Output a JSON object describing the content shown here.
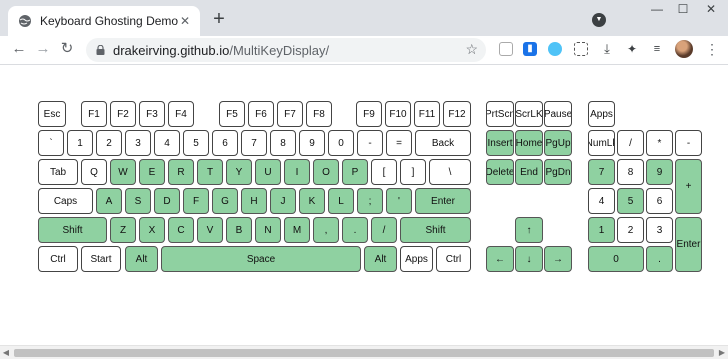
{
  "browser": {
    "tab_title": "Keyboard Ghosting Demonstratio",
    "tab_close": "✕",
    "new_tab": "+",
    "url_host": "drakeirving.github.io",
    "url_path": "/MultiKeyDisplay/",
    "back": "←",
    "forward": "→",
    "reload": "↻",
    "star": "☆",
    "menu": "⋮",
    "window_minimize": "—",
    "window_maximize": "☐",
    "window_close": "✕"
  },
  "colors": {
    "active_key": "#8fd1a1",
    "tab_strip": "#dee1e6"
  },
  "keys": [
    {
      "id": "esc",
      "label": "Esc",
      "active": false
    },
    {
      "id": "f1",
      "label": "F1",
      "active": false
    },
    {
      "id": "f2",
      "label": "F2",
      "active": false
    },
    {
      "id": "f3",
      "label": "F3",
      "active": false
    },
    {
      "id": "f4",
      "label": "F4",
      "active": false
    },
    {
      "id": "f5",
      "label": "F5",
      "active": false
    },
    {
      "id": "f6",
      "label": "F6",
      "active": false
    },
    {
      "id": "f7",
      "label": "F7",
      "active": false
    },
    {
      "id": "f8",
      "label": "F8",
      "active": false
    },
    {
      "id": "f9",
      "label": "F9",
      "active": false
    },
    {
      "id": "f10",
      "label": "F10",
      "active": false
    },
    {
      "id": "f11",
      "label": "F11",
      "active": false
    },
    {
      "id": "f12",
      "label": "F12",
      "active": false
    },
    {
      "id": "prtscn",
      "label": "PrtScn",
      "active": false
    },
    {
      "id": "scrlk",
      "label": "ScrLK",
      "active": false
    },
    {
      "id": "pause",
      "label": "Pause",
      "active": false
    },
    {
      "id": "apps-top",
      "label": "Apps",
      "active": false
    },
    {
      "id": "backtick",
      "label": "`",
      "active": false
    },
    {
      "id": "d1",
      "label": "1",
      "active": false
    },
    {
      "id": "d2",
      "label": "2",
      "active": false
    },
    {
      "id": "d3",
      "label": "3",
      "active": false
    },
    {
      "id": "d4",
      "label": "4",
      "active": false
    },
    {
      "id": "d5",
      "label": "5",
      "active": false
    },
    {
      "id": "d6",
      "label": "6",
      "active": false
    },
    {
      "id": "d7",
      "label": "7",
      "active": false
    },
    {
      "id": "d8",
      "label": "8",
      "active": false
    },
    {
      "id": "d9",
      "label": "9",
      "active": false
    },
    {
      "id": "d0",
      "label": "0",
      "active": false
    },
    {
      "id": "minus",
      "label": "-",
      "active": false
    },
    {
      "id": "equals",
      "label": "=",
      "active": false
    },
    {
      "id": "backspace",
      "label": "Back",
      "active": false
    },
    {
      "id": "insert",
      "label": "Insert",
      "active": true
    },
    {
      "id": "home",
      "label": "Home",
      "active": true
    },
    {
      "id": "pgup",
      "label": "PgUp",
      "active": true
    },
    {
      "id": "numlk",
      "label": "NumLk",
      "active": false
    },
    {
      "id": "np-div",
      "label": "/",
      "active": false
    },
    {
      "id": "np-mul",
      "label": "*",
      "active": false
    },
    {
      "id": "np-sub",
      "label": "-",
      "active": false
    },
    {
      "id": "tab",
      "label": "Tab",
      "active": false
    },
    {
      "id": "q",
      "label": "Q",
      "active": false
    },
    {
      "id": "w",
      "label": "W",
      "active": true
    },
    {
      "id": "e",
      "label": "E",
      "active": true
    },
    {
      "id": "r",
      "label": "R",
      "active": true
    },
    {
      "id": "t",
      "label": "T",
      "active": true
    },
    {
      "id": "y",
      "label": "Y",
      "active": true
    },
    {
      "id": "u",
      "label": "U",
      "active": true
    },
    {
      "id": "i",
      "label": "I",
      "active": true
    },
    {
      "id": "o",
      "label": "O",
      "active": true
    },
    {
      "id": "p",
      "label": "P",
      "active": true
    },
    {
      "id": "lbracket",
      "label": "[",
      "active": false
    },
    {
      "id": "rbracket",
      "label": "]",
      "active": false
    },
    {
      "id": "backslash",
      "label": "\\",
      "active": false
    },
    {
      "id": "delete",
      "label": "Delete",
      "active": true
    },
    {
      "id": "end",
      "label": "End",
      "active": true
    },
    {
      "id": "pgdn",
      "label": "PgDn",
      "active": true
    },
    {
      "id": "np7",
      "label": "7",
      "active": true
    },
    {
      "id": "np8",
      "label": "8",
      "active": false
    },
    {
      "id": "np9",
      "label": "9",
      "active": true
    },
    {
      "id": "np-add",
      "label": "+",
      "active": true
    },
    {
      "id": "caps",
      "label": "Caps",
      "active": false
    },
    {
      "id": "a",
      "label": "A",
      "active": true
    },
    {
      "id": "s",
      "label": "S",
      "active": true
    },
    {
      "id": "d",
      "label": "D",
      "active": true
    },
    {
      "id": "f",
      "label": "F",
      "active": true
    },
    {
      "id": "g",
      "label": "G",
      "active": true
    },
    {
      "id": "h",
      "label": "H",
      "active": true
    },
    {
      "id": "j",
      "label": "J",
      "active": true
    },
    {
      "id": "k",
      "label": "K",
      "active": true
    },
    {
      "id": "l",
      "label": "L",
      "active": true
    },
    {
      "id": "semicolon",
      "label": ";",
      "active": true
    },
    {
      "id": "quote",
      "label": "'",
      "active": true
    },
    {
      "id": "enter",
      "label": "Enter",
      "active": true
    },
    {
      "id": "np4",
      "label": "4",
      "active": false
    },
    {
      "id": "np5",
      "label": "5",
      "active": true
    },
    {
      "id": "np6",
      "label": "6",
      "active": false
    },
    {
      "id": "lshift",
      "label": "Shift",
      "active": true
    },
    {
      "id": "z",
      "label": "Z",
      "active": true
    },
    {
      "id": "x",
      "label": "X",
      "active": true
    },
    {
      "id": "c",
      "label": "C",
      "active": true
    },
    {
      "id": "v",
      "label": "V",
      "active": true
    },
    {
      "id": "b",
      "label": "B",
      "active": true
    },
    {
      "id": "n",
      "label": "N",
      "active": true
    },
    {
      "id": "m",
      "label": "M",
      "active": true
    },
    {
      "id": "comma",
      "label": ",",
      "active": true
    },
    {
      "id": "period",
      "label": ".",
      "active": true
    },
    {
      "id": "slash",
      "label": "/",
      "active": true
    },
    {
      "id": "rshift",
      "label": "Shift",
      "active": true
    },
    {
      "id": "up",
      "label": "↑",
      "active": true
    },
    {
      "id": "np1",
      "label": "1",
      "active": true
    },
    {
      "id": "np2",
      "label": "2",
      "active": false
    },
    {
      "id": "np3",
      "label": "3",
      "active": false
    },
    {
      "id": "np-enter",
      "label": "Enter",
      "active": true
    },
    {
      "id": "lctrl",
      "label": "Ctrl",
      "active": false
    },
    {
      "id": "start",
      "label": "Start",
      "active": false
    },
    {
      "id": "lalt",
      "label": "Alt",
      "active": true
    },
    {
      "id": "space",
      "label": "Space",
      "active": true
    },
    {
      "id": "ralt",
      "label": "Alt",
      "active": true
    },
    {
      "id": "apps",
      "label": "Apps",
      "active": false
    },
    {
      "id": "rctrl",
      "label": "Ctrl",
      "active": false
    },
    {
      "id": "left",
      "label": "←",
      "active": true
    },
    {
      "id": "down",
      "label": "↓",
      "active": true
    },
    {
      "id": "right",
      "label": "→",
      "active": true
    },
    {
      "id": "np0",
      "label": "0",
      "active": true
    },
    {
      "id": "np-dot",
      "label": ".",
      "active": true
    }
  ]
}
